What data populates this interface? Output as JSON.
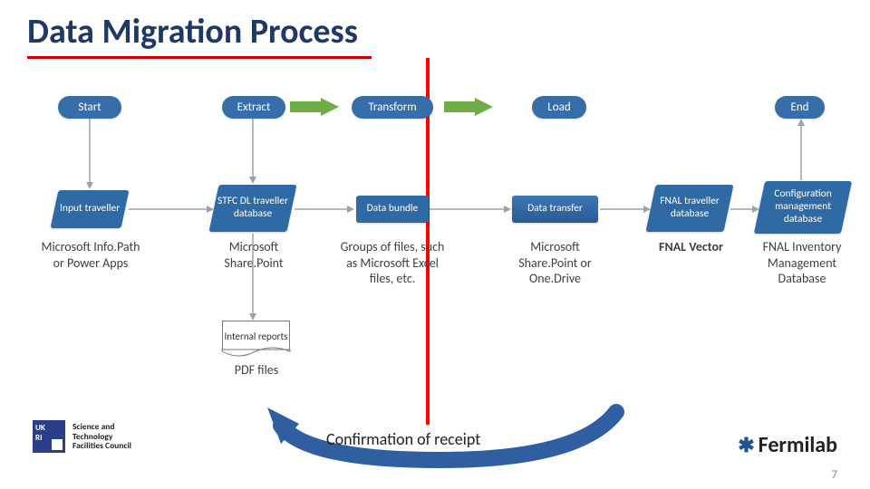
{
  "title": "Data Migration Process",
  "stages": {
    "start": "Start",
    "extract": "Extract",
    "transform": "Transform",
    "load": "Load",
    "end": "End"
  },
  "boxes": {
    "input_traveller": "Input traveller",
    "stfc_db": "STFC DL traveller database",
    "data_bundle": "Data bundle",
    "data_transfer": "Data transfer",
    "fnal_db": "FNAL traveller database",
    "config_db": "Configuration management database",
    "internal_reports": "Internal reports"
  },
  "captions": {
    "c1": "Microsoft Info.Path or Power Apps",
    "c2": "Microsoft Share.Point",
    "c3": "Groups of files, such as Microsoft Excel files, etc.",
    "c4": "Microsoft Share.Point or One.Drive",
    "c5": "FNAL Vector",
    "c6": "FNAL Inventory Management Database",
    "c7": "PDF files"
  },
  "confirmation": "Confirmation of receipt",
  "page_number": "7",
  "logos": {
    "ukri_short": "UK\nRI",
    "ukri_text": "Science and\nTechnology\nFacilities Council",
    "fermi": "Fermilab"
  }
}
